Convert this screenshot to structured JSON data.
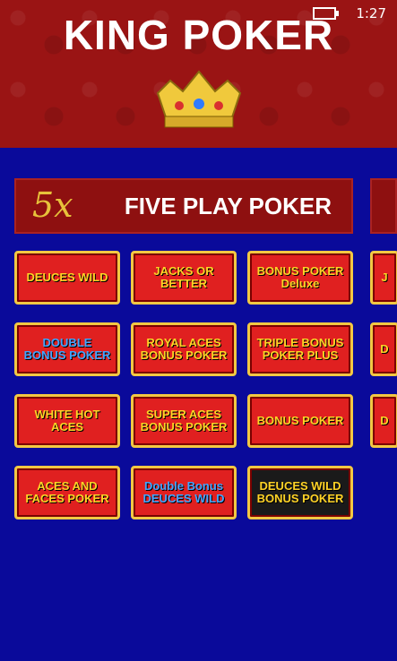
{
  "status_bar": {
    "time": "1:27"
  },
  "header": {
    "title": "KING POKER"
  },
  "banners": [
    {
      "multiplier": "5x",
      "label": "FIVE PLAY POKER"
    }
  ],
  "games": [
    {
      "name": "DEUCES WILD"
    },
    {
      "name": "JACKS OR BETTER"
    },
    {
      "name": "BONUS POKER Deluxe"
    },
    {
      "name": "DOUBLE BONUS POKER"
    },
    {
      "name": "ROYAL ACES BONUS POKER"
    },
    {
      "name": "TRIPLE BONUS POKER PLUS"
    },
    {
      "name": "WHITE HOT ACES"
    },
    {
      "name": "SUPER ACES BONUS POKER"
    },
    {
      "name": "BONUS POKER"
    },
    {
      "name": "ACES AND FACES POKER"
    },
    {
      "name": "Double Bonus DEUCES WILD"
    },
    {
      "name": "DEUCES WILD BONUS POKER"
    }
  ],
  "peek_tiles": [
    {
      "text": "J"
    },
    {
      "text": "D"
    },
    {
      "text": "D"
    }
  ]
}
